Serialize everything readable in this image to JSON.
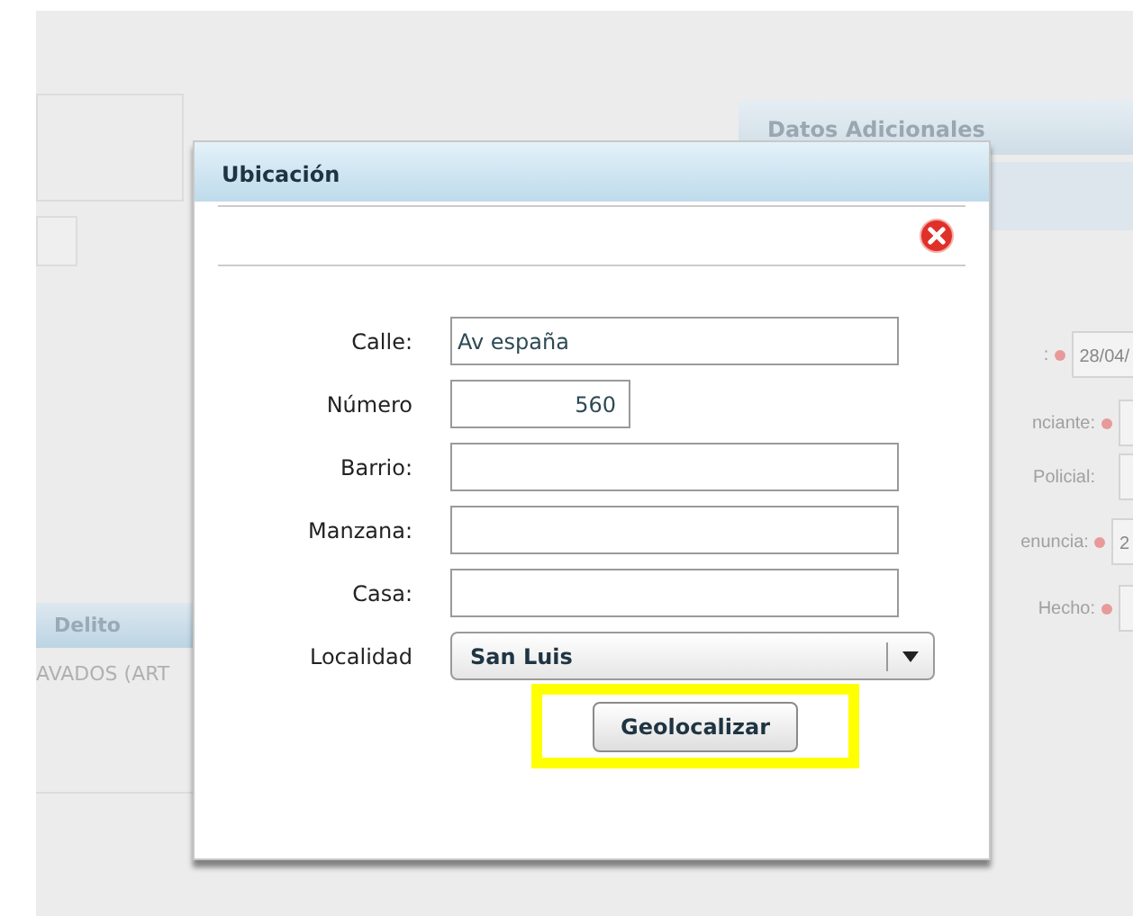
{
  "background": {
    "panels": [
      {
        "title": "Datos Adicionales"
      },
      {
        "title": "Delito"
      }
    ],
    "delito_text": "AVADOS (ART",
    "fields": [
      {
        "label": ":",
        "value": "28/04/",
        "required": true
      },
      {
        "label": "nciante:",
        "required": true
      },
      {
        "label": "Policial:",
        "required": false
      },
      {
        "label": "enuncia:",
        "value": "2",
        "required": true
      },
      {
        "label": "Hecho:",
        "required": true
      }
    ]
  },
  "dialog": {
    "title": "Ubicación",
    "fields": [
      {
        "label": "Calle:",
        "value": "Av españa",
        "kind": "text"
      },
      {
        "label": "Número",
        "value": "560",
        "kind": "number"
      },
      {
        "label": "Barrio:",
        "kind": "text"
      },
      {
        "label": "Manzana:",
        "kind": "text"
      },
      {
        "label": "Casa:",
        "kind": "text"
      },
      {
        "label": "Localidad",
        "value": "San Luis",
        "kind": "select"
      }
    ],
    "button": "Geolocalizar",
    "highlighted": true
  }
}
